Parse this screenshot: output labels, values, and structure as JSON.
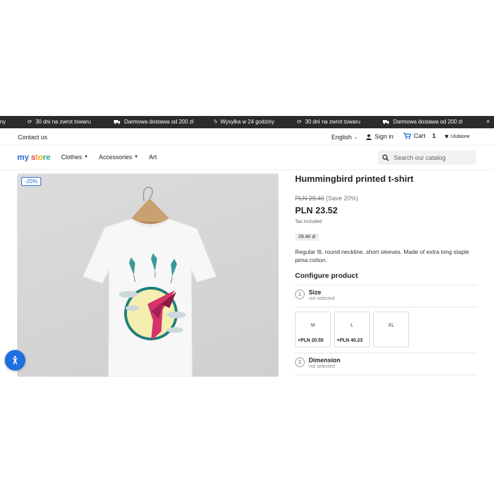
{
  "promo": {
    "items": [
      {
        "text": "iny",
        "icon": "none"
      },
      {
        "text": "30 dni na zwrot towaru",
        "icon": "refresh-icon"
      },
      {
        "text": "Darmowa dostawa od 200 zł",
        "icon": "truck-icon"
      },
      {
        "text": "Wysyłka w 24 godziny",
        "icon": "bolt-icon"
      },
      {
        "text": "30 dni na zwrot towaru",
        "icon": "refresh-icon"
      },
      {
        "text": "Darmowa dostawa od 200 zł",
        "icon": "truck-icon"
      }
    ],
    "close": "×"
  },
  "topnav": {
    "contact": "Contact us",
    "language": "English",
    "signin": "Sign in",
    "cart": "Cart",
    "cart_count": "1",
    "favorites": "Ulubione"
  },
  "header": {
    "logo": {
      "a": "my",
      "b": "s",
      "c": "to",
      "d": "re"
    },
    "menu": [
      "Clothes",
      "Accessories",
      "Art"
    ],
    "search_placeholder": "Search our catalog"
  },
  "product": {
    "discount_badge": "-20%",
    "title": "Hummingbird printed t-shirt",
    "old_price": "PLN 29.40",
    "save": "(Save 20%)",
    "price": "PLN 23.52",
    "tax": "Tax included",
    "price_chip": "29.40 zł",
    "description": "Regular fit, round neckline, short sleeves. Made of extra long staple pima cotton.",
    "configure": "Configure product",
    "steps": [
      {
        "num": "1",
        "name": "Size",
        "status": "not selected"
      },
      {
        "num": "2",
        "name": "Dimension",
        "status": "not selected"
      }
    ],
    "sizes": [
      {
        "label": "M",
        "add": "+PLN 20.55"
      },
      {
        "label": "L",
        "add": "+PLN 40.23"
      },
      {
        "label": "XL",
        "add": ""
      }
    ]
  },
  "colors": {
    "accent": "#2a6fdb",
    "promo_bg": "#2b2b2b",
    "a11y": "#1e6fe0"
  }
}
